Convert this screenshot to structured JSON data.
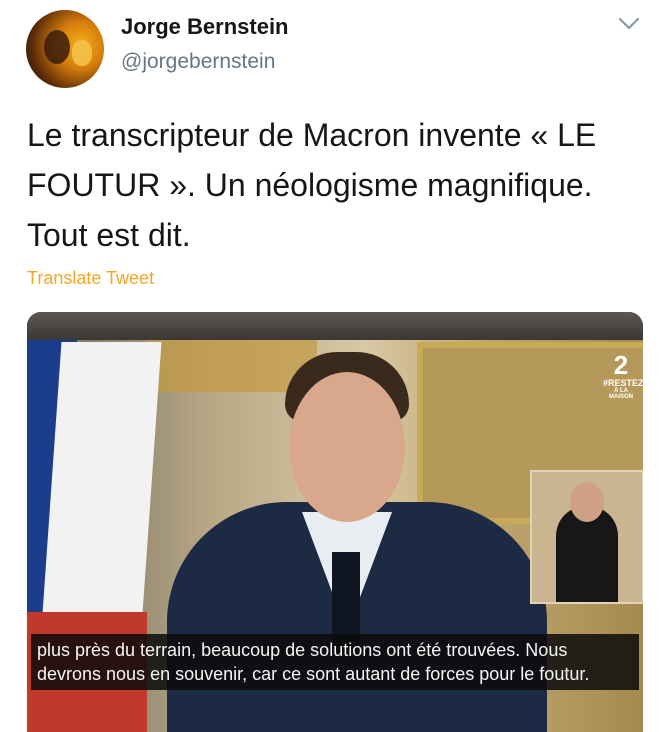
{
  "user": {
    "display_name": "Jorge Bernstein",
    "handle": "@jorgebernstein"
  },
  "menu_icon": "chevron-down-icon",
  "tweet": {
    "text": "Le transcripteur de Macron invente « LE FOUTUR ». Un néologisme magnifique. Tout est dit.",
    "translate_label": "Translate Tweet"
  },
  "media": {
    "channel_number": "2",
    "channel_tag": "#RESTEZ",
    "channel_sub": "À LA MAISON",
    "subtitle_line1": "plus près du terrain, beaucoup de solutions ont été trouvées. Nous",
    "subtitle_line2": "devrons nous en souvenir, car ce sont autant de forces pour le foutur."
  },
  "colors": {
    "translate": "#f5a623",
    "handle": "#657786",
    "text": "#14171a"
  }
}
